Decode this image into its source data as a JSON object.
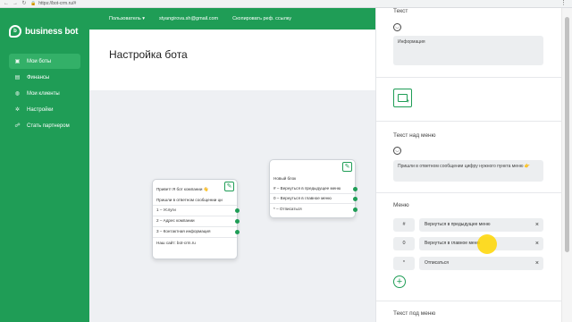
{
  "browser": {
    "url": "https://bot-crm.ru/#"
  },
  "sidebar": {
    "logo_text": "business bot",
    "items": [
      {
        "label": "Мои боты",
        "icon": "bot-icon",
        "active": true
      },
      {
        "label": "Финансы",
        "icon": "wallet-icon",
        "active": false
      },
      {
        "label": "Мои клиенты",
        "icon": "clients-icon",
        "active": false
      },
      {
        "label": "Настройки",
        "icon": "gear-icon",
        "active": false
      },
      {
        "label": "Стать партнером",
        "icon": "partner-icon",
        "active": false
      }
    ]
  },
  "topbar": {
    "user_menu": "Пользователь ▾",
    "email": "styangirova.sh@gmail.com",
    "copy_ref": "Скопировать реф. ссылку"
  },
  "page": {
    "title": "Настройка бота"
  },
  "cards": [
    {
      "lines": [
        "Привет! Я бот компании 👋",
        "Пришли в ответном сообщении ци",
        "1 – Услуги",
        "2 – Адрес компании",
        "3 – Контактная информация",
        "Наш сайт: bot-crm.ru"
      ]
    },
    {
      "lines": [
        "Новый блок",
        "# – Вернуться в предыдущее меню",
        "0 – Вернуться в главное меню",
        "* – Отписаться"
      ]
    }
  ],
  "panel": {
    "text_label": "Текст",
    "text_value": "Информация",
    "text_above_menu_label": "Текст над меню",
    "text_above_menu_value": "Пришли в ответном сообщении цифру нужного пункта меню 👉",
    "menu_label": "Меню",
    "menu_items": [
      {
        "key": "#",
        "value": "Вернуться в предыдущее меню"
      },
      {
        "key": "0",
        "value": "Вернуться в главное меню"
      },
      {
        "key": "*",
        "value": "Отписаться"
      }
    ],
    "bottom_label": "Текст под меню"
  },
  "colors": {
    "brand_green": "#1f9d56",
    "active_item": "#33b068",
    "canvas_bg": "#eef0f3"
  }
}
